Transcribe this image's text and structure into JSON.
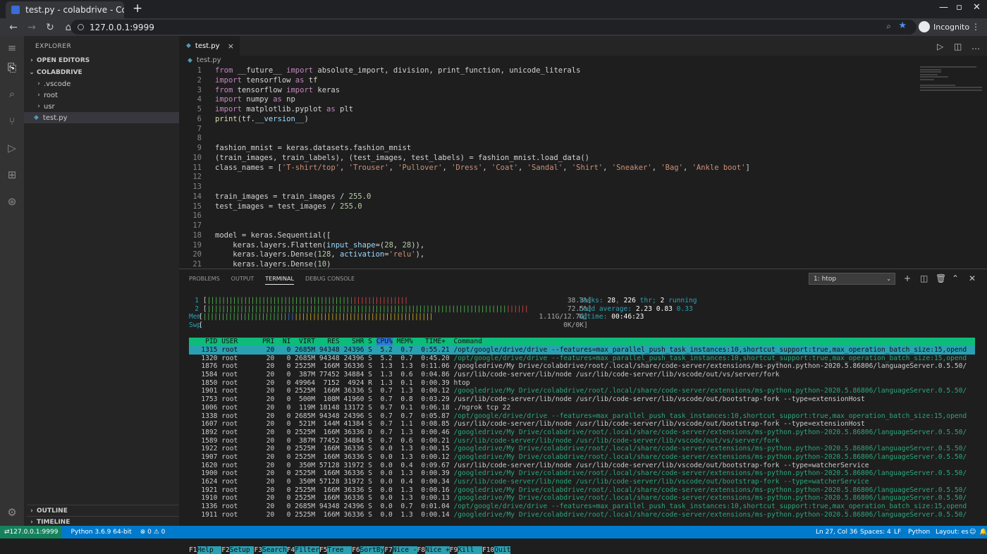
{
  "browser": {
    "tab_title": "test.py - colabdrive - Code",
    "url": "127.0.0.1:9999",
    "profile_label": "Incognito"
  },
  "explorer": {
    "title": "EXPLORER",
    "open_editors": "OPEN EDITORS",
    "workspace": "COLABDRIVE",
    "items": [
      {
        "label": ".vscode"
      },
      {
        "label": "root"
      },
      {
        "label": "usr"
      },
      {
        "label": "test.py"
      }
    ],
    "outline": "OUTLINE",
    "timeline": "TIMELINE"
  },
  "editor": {
    "tab_label": "test.py",
    "breadcrumb": "test.py",
    "line_numbers": [
      "1",
      "2",
      "3",
      "4",
      "5",
      "6",
      "7",
      "8",
      "9",
      "10",
      "11",
      "12",
      "13",
      "14",
      "15",
      "16",
      "17",
      "18",
      "19",
      "20",
      "21"
    ]
  },
  "panel": {
    "tabs": [
      "PROBLEMS",
      "OUTPUT",
      "TERMINAL",
      "DEBUG CONSOLE"
    ],
    "active_tab": "TERMINAL",
    "terminal_select": "1: htop"
  },
  "htop": {
    "meters": [
      {
        "label": "1",
        "value": "38.3%]"
      },
      {
        "label": "2",
        "value": "72.5%]"
      },
      {
        "label": "Mem",
        "value": "1.11G/12.7G]"
      },
      {
        "label": "Swp",
        "value": "0K/0K]"
      }
    ],
    "tasks_label": "Tasks: ",
    "tasks": "28",
    "threads": "226",
    "running": "2",
    "load_label": "Load average: ",
    "load1": "2.23",
    "load5": "0.83",
    "load15": "0.33",
    "uptime_label": "Uptime: ",
    "uptime": "00:46:23",
    "header": "    PID USER      PRI  NI  VIRT   RES   SHR S ",
    "header_cpu": "CPU%",
    "header_rest": " MEM%   TIME+  Command",
    "processes": [
      {
        "cols": "   1315 root       20   0 2685M 94348 24396 S  5.2  0.7  0:55.21 ",
        "cmd": "/opt/google/drive/drive --features=max_parallel_push_task_instances:10,shortcut_support:true,max_operation_batch_size:15,opend",
        "green": false,
        "selected": true
      },
      {
        "cols": "   1320 root       20   0 2685M 94348 24396 S  5.2  0.7  0:45.20 ",
        "cmd": "/opt/google/drive/drive --features=max_parallel_push_task_instances:10,shortcut_support:true,max_operation_batch_size:15,opend",
        "green": true,
        "selected": false
      },
      {
        "cols": "   1876 root       20   0 2525M  166M 36336 S  1.3  1.3  0:11.06 ",
        "cmd": "/googledrive/My Drive/colabdrive/root/.local/share/code-server/extensions/ms-python.python-2020.5.86806/languageServer.0.5.50/",
        "green": false,
        "selected": false
      },
      {
        "cols": "   1584 root       20   0  387M 77452 34884 S  1.3  0.6  0:04.86 ",
        "cmd": "/usr/lib/code-server/lib/node /usr/lib/code-server/lib/vscode/out/vs/server/fork",
        "green": false,
        "selected": false
      },
      {
        "cols": "   1850 root       20   0 49964  7152  4924 R  1.3  0.1  0:00.39 ",
        "cmd": "htop",
        "green": false,
        "selected": false
      },
      {
        "cols": "   1901 root       20   0 2525M  166M 36336 S  0.7  1.3  0:00.12 ",
        "cmd": "/googledrive/My Drive/colabdrive/root/.local/share/code-server/extensions/ms-python.python-2020.5.86806/languageServer.0.5.50/",
        "green": true,
        "selected": false
      },
      {
        "cols": "   1753 root       20   0  500M  108M 41960 S  0.7  0.8  0:03.29 ",
        "cmd": "/usr/lib/code-server/lib/node /usr/lib/code-server/lib/vscode/out/bootstrap-fork --type=extensionHost",
        "green": false,
        "selected": false
      },
      {
        "cols": "   1006 root       20   0  119M 18148 13172 S  0.7  0.1  0:06.18 ",
        "cmd": "./ngrok tcp 22",
        "green": false,
        "selected": false
      },
      {
        "cols": "   1338 root       20   0 2685M 94348 24396 S  0.7  0.7  0:05.87 ",
        "cmd": "/opt/google/drive/drive --features=max_parallel_push_task_instances:10,shortcut_support:true,max_operation_batch_size:15,opend",
        "green": true,
        "selected": false
      },
      {
        "cols": "   1607 root       20   0  521M  144M 41384 S  0.7  1.1  0:08.85 ",
        "cmd": "/usr/lib/code-server/lib/node /usr/lib/code-server/lib/vscode/out/bootstrap-fork --type=extensionHost",
        "green": false,
        "selected": false
      },
      {
        "cols": "   1892 root       20   0 2525M  166M 36336 D  0.7  1.3  0:00.46 ",
        "cmd": "/googledrive/My Drive/colabdrive/root/.local/share/code-server/extensions/ms-python.python-2020.5.86806/languageServer.0.5.50/",
        "green": true,
        "selected": false
      },
      {
        "cols": "   1589 root       20   0  387M 77452 34884 S  0.7  0.6  0:00.21 ",
        "cmd": "/usr/lib/code-server/lib/node /usr/lib/code-server/lib/vscode/out/vs/server/fork",
        "green": true,
        "selected": false
      },
      {
        "cols": "   1922 root       20   0 2525M  166M 36336 S  0.0  1.3  0:00.15 ",
        "cmd": "/googledrive/My Drive/colabdrive/root/.local/share/code-server/extensions/ms-python.python-2020.5.86806/languageServer.0.5.50/",
        "green": true,
        "selected": false
      },
      {
        "cols": "   1907 root       20   0 2525M  166M 36336 S  0.0  1.3  0:00.12 ",
        "cmd": "/googledrive/My Drive/colabdrive/root/.local/share/code-server/extensions/ms-python.python-2020.5.86806/languageServer.0.5.50/",
        "green": true,
        "selected": false
      },
      {
        "cols": "   1620 root       20   0  350M 57128 31972 S  0.0  0.4  0:09.67 ",
        "cmd": "/usr/lib/code-server/lib/node /usr/lib/code-server/lib/vscode/out/bootstrap-fork --type=watcherService",
        "green": false,
        "selected": false
      },
      {
        "cols": "   1900 root       20   0 2525M  166M 36336 S  0.0  1.3  0:00.39 ",
        "cmd": "/googledrive/My Drive/colabdrive/root/.local/share/code-server/extensions/ms-python.python-2020.5.86806/languageServer.0.5.50/",
        "green": true,
        "selected": false
      },
      {
        "cols": "   1624 root       20   0  350M 57128 31972 S  0.0  0.4  0:00.34 ",
        "cmd": "/usr/lib/code-server/lib/node /usr/lib/code-server/lib/vscode/out/bootstrap-fork --type=watcherService",
        "green": true,
        "selected": false
      },
      {
        "cols": "   1921 root       20   0 2525M  166M 36336 S  0.0  1.3  0:00.16 ",
        "cmd": "/googledrive/My Drive/colabdrive/root/.local/share/code-server/extensions/ms-python.python-2020.5.86806/languageServer.0.5.50/",
        "green": true,
        "selected": false
      },
      {
        "cols": "   1910 root       20   0 2525M  166M 36336 S  0.0  1.3  0:00.13 ",
        "cmd": "/googledrive/My Drive/colabdrive/root/.local/share/code-server/extensions/ms-python.python-2020.5.86806/languageServer.0.5.50/",
        "green": true,
        "selected": false
      },
      {
        "cols": "   1336 root       20   0 2685M 94348 24396 S  0.0  0.7  0:01.04 ",
        "cmd": "/opt/google/drive/drive --features=max_parallel_push_task_instances:10,shortcut_support:true,max_operation_batch_size:15,opend",
        "green": true,
        "selected": false
      },
      {
        "cols": "   1911 root       20   0 2525M  166M 36336 S  0.0  1.3  0:00.14 ",
        "cmd": "/googledrive/My Drive/colabdrive/root/.local/share/code-server/extensions/ms-python.python-2020.5.86806/languageServer.0.5.50/",
        "green": true,
        "selected": false
      }
    ],
    "fkeys": [
      {
        "key": "F1",
        "label": "Help  "
      },
      {
        "key": "F2",
        "label": "Setup "
      },
      {
        "key": "F3",
        "label": "Search"
      },
      {
        "key": "F4",
        "label": "Filter"
      },
      {
        "key": "F5",
        "label": "Tree  "
      },
      {
        "key": "F6",
        "label": "SortBy"
      },
      {
        "key": "F7",
        "label": "Nice -"
      },
      {
        "key": "F8",
        "label": "Nice +"
      },
      {
        "key": "F9",
        "label": "Kill  "
      },
      {
        "key": "F10",
        "label": "Quit"
      }
    ]
  },
  "statusbar": {
    "remote": "127.0.0.1:9999",
    "interpreter": "Python 3.6.9 64-bit",
    "problems": "⊗ 0 ⚠ 0",
    "position": "Ln 27, Col 36",
    "spaces": "Spaces: 4",
    "eol": "LF",
    "language": "Python",
    "layout": "Layout: es"
  }
}
